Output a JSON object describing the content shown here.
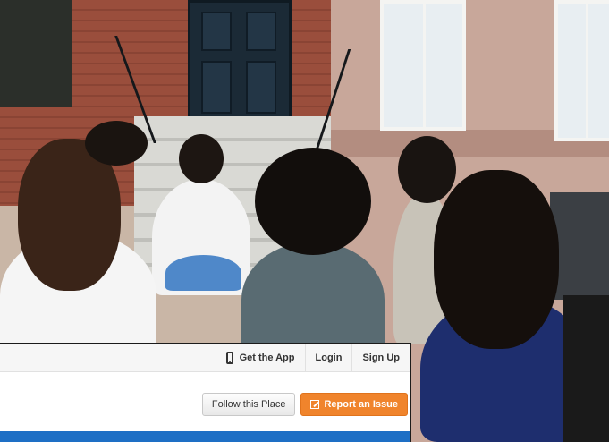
{
  "widget": {
    "nav": {
      "get_app": "Get the App",
      "login": "Login",
      "signup": "Sign Up"
    },
    "actions": {
      "follow": "Follow this Place",
      "report": "Report an Issue"
    },
    "colors": {
      "accent": "#f0842c",
      "bar": "#1e6fc5"
    }
  }
}
